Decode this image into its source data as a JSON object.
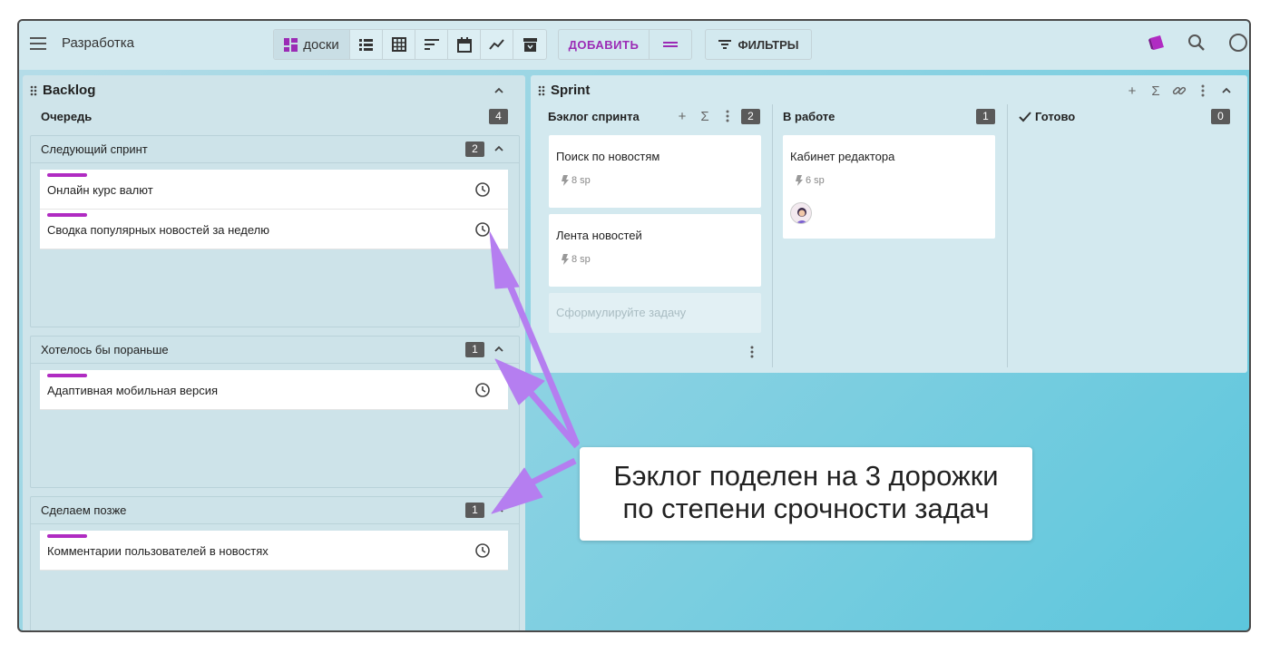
{
  "header": {
    "board_title": "Разработка",
    "view_active_label": "доски",
    "add_label": "ДОБАВИТЬ",
    "filters_label": "ФИЛЬТРЫ"
  },
  "backlog": {
    "title": "Backlog",
    "queue_label": "Очередь",
    "queue_count": "4",
    "lanes": [
      {
        "title": "Следующий спринт",
        "count": "2",
        "cards": [
          "Онлайн курс валют",
          "Сводка популярных новостей за неделю"
        ]
      },
      {
        "title": "Хотелось бы пораньше",
        "count": "1",
        "cards": [
          "Адаптивная мобильная версия"
        ]
      },
      {
        "title": "Сделаем позже",
        "count": "1",
        "cards": [
          "Комментарии пользователей в новостях"
        ]
      }
    ]
  },
  "sprint": {
    "title": "Sprint",
    "columns": [
      {
        "title": "Бэклог спринта",
        "count": "2"
      },
      {
        "title": "В работе",
        "count": "1"
      },
      {
        "title": "Готово",
        "count": "0"
      }
    ],
    "cards": [
      {
        "title": "Поиск по новостям",
        "points": "8 sp"
      },
      {
        "title": "Лента новостей",
        "points": "8 sp"
      },
      {
        "title": "Кабинет редактора",
        "points": "6 sp"
      }
    ],
    "new_task_placeholder": "Сформулируйте задачу"
  },
  "callout": {
    "line1": "Бэклог поделен на 3 дорожки",
    "line2": "по степени срочности задач"
  },
  "colors": {
    "accent": "#9b2bb5",
    "card_bar": "#b02bc2",
    "arrow": "#b57ef0"
  }
}
